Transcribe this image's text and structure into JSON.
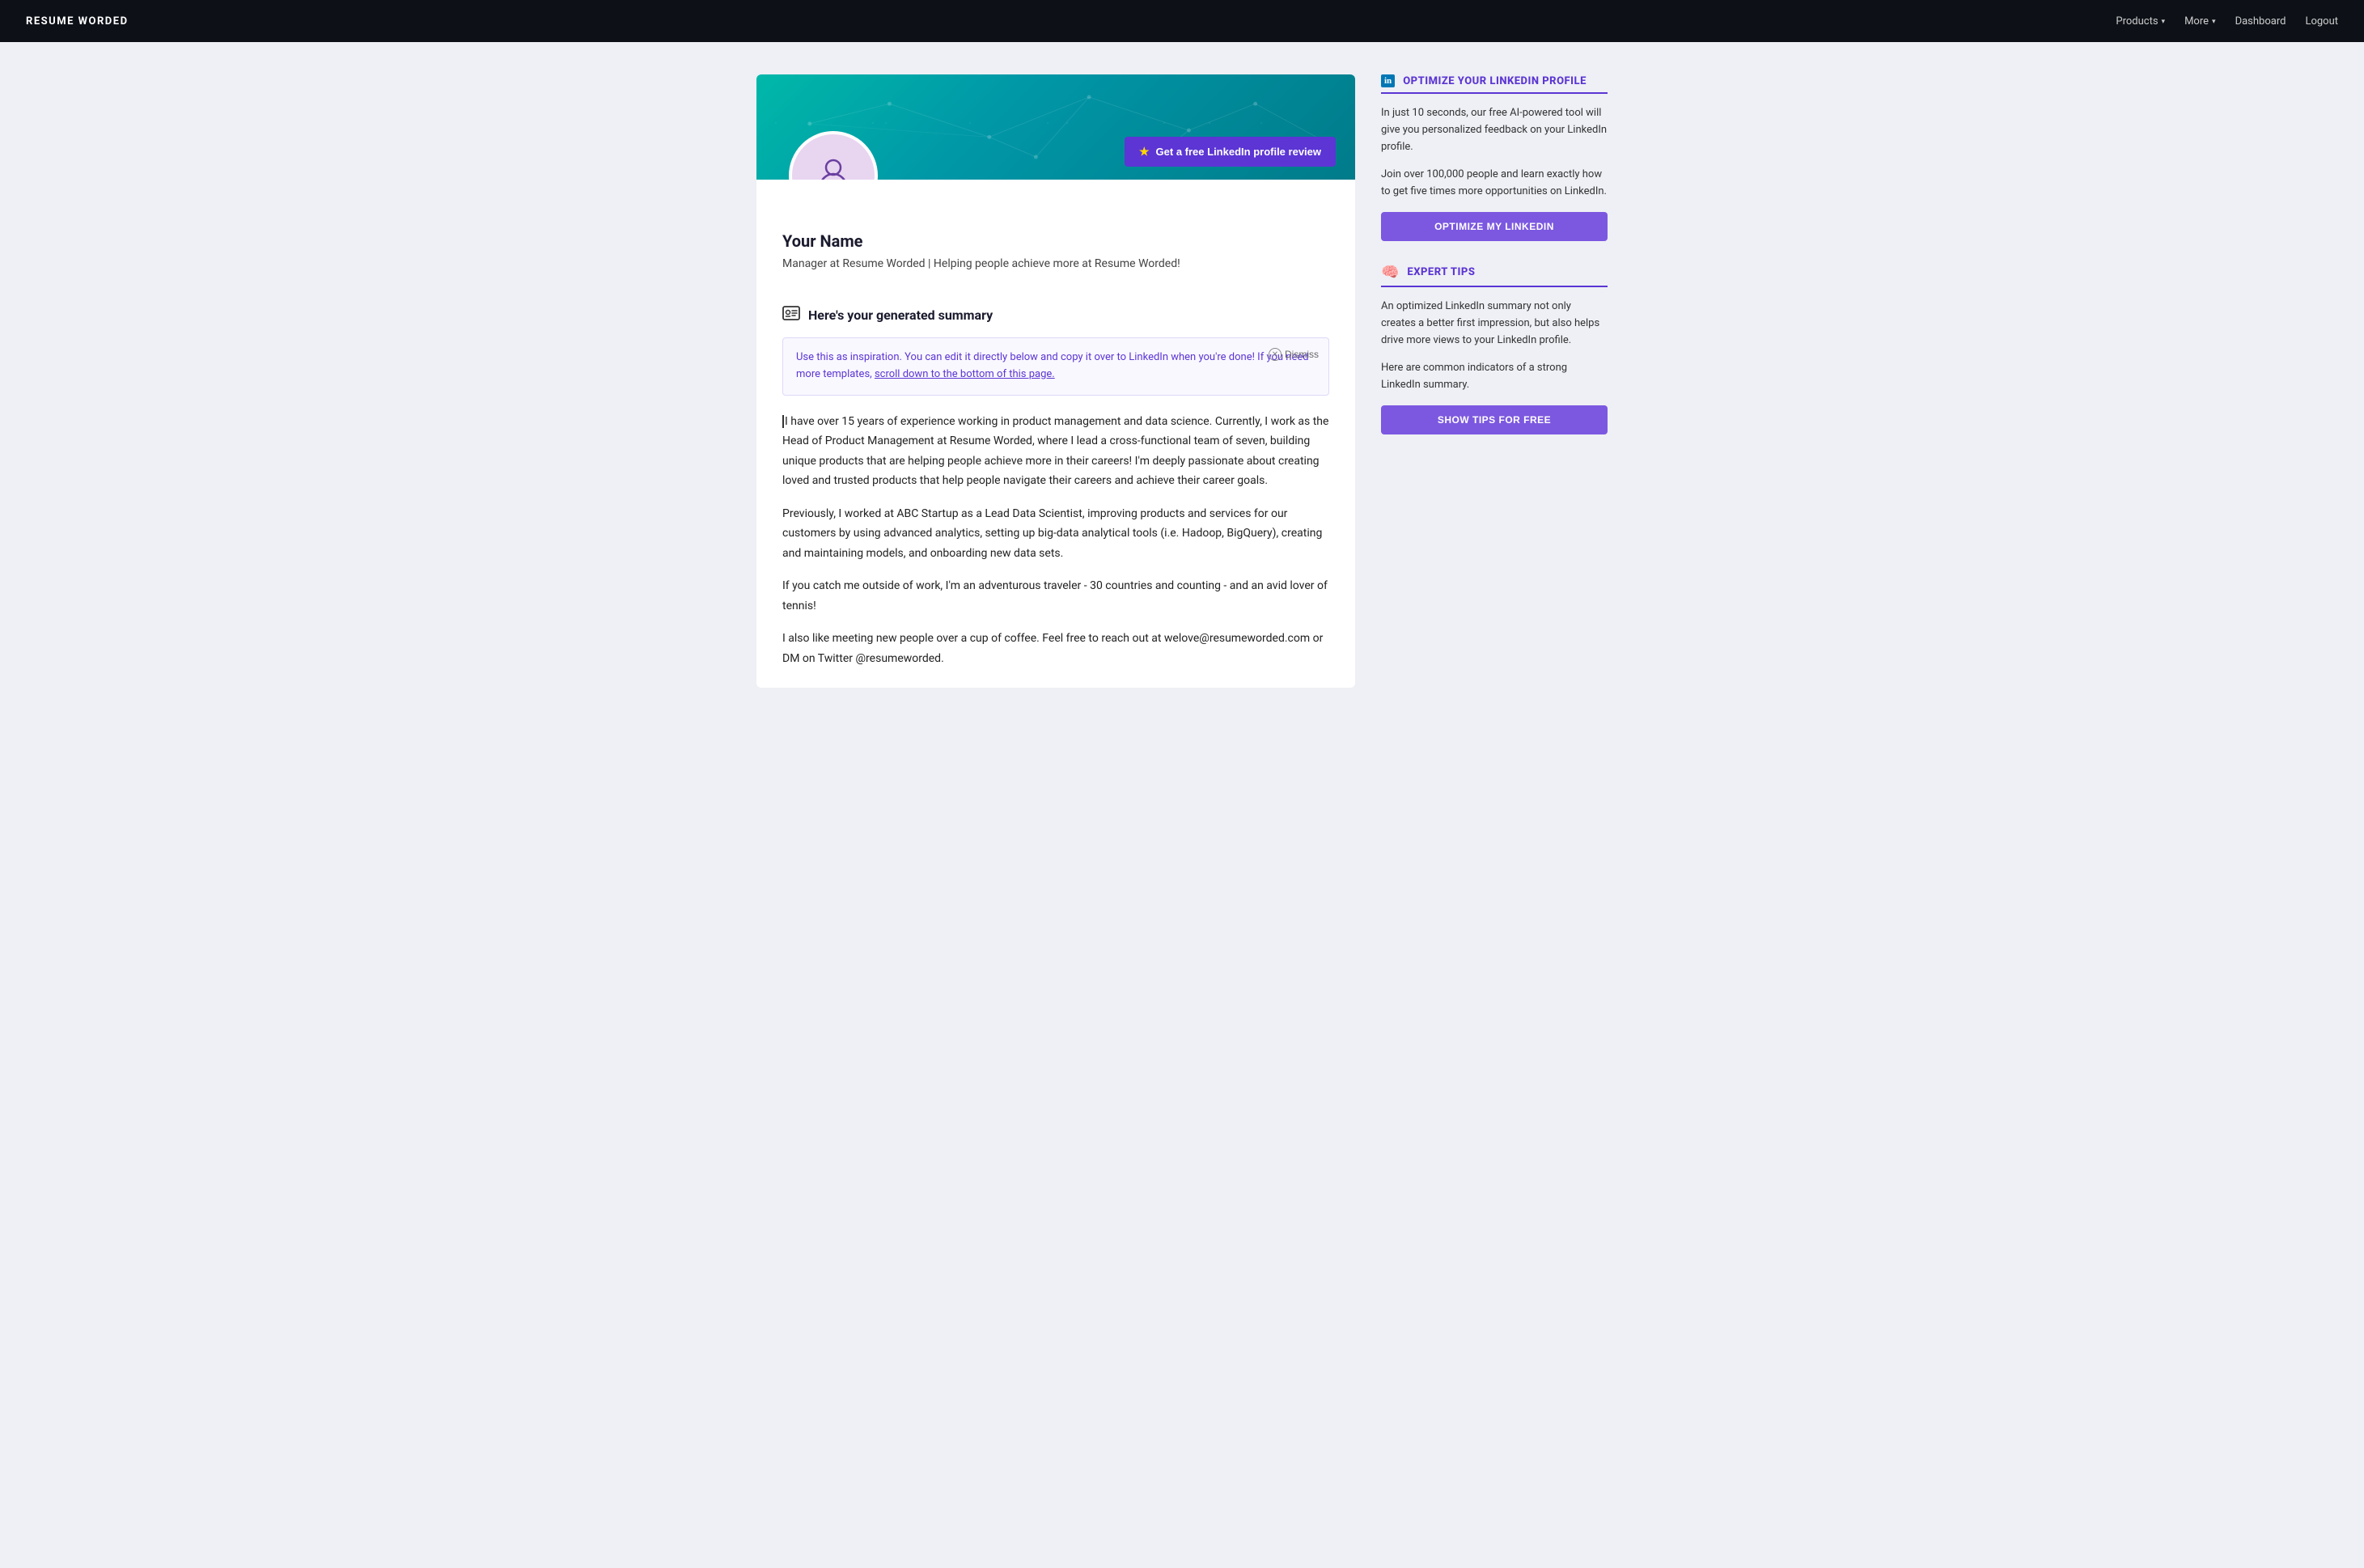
{
  "nav": {
    "logo": "RESUME WORDED",
    "products_label": "Products",
    "more_label": "More",
    "dashboard_label": "Dashboard",
    "logout_label": "Logout"
  },
  "profile": {
    "name": "Your Name",
    "title": "Manager at Resume Worded | Helping people achieve more at Resume Worded!",
    "cta_button": "Get a free LinkedIn profile review"
  },
  "summary": {
    "heading": "Here's your generated summary",
    "info_box_text": "Use this as inspiration. You can edit it directly below and copy it over to LinkedIn when you're done! If you need more templates, scroll down to the bottom of this page.",
    "dismiss_label": "Dismiss",
    "paragraph1": "I have over 15 years of experience working in product management and data science. Currently, I work as the Head of Product Management at Resume Worded, where I lead a cross-functional team of seven, building unique products that are helping people achieve more in their careers! I'm deeply passionate about creating loved and trusted products that help people navigate their careers and achieve their career goals.",
    "paragraph2": "Previously, I worked at ABC Startup as a Lead Data Scientist, improving products and services for our customers by using advanced analytics, setting up big-data analytical tools (i.e. Hadoop, BigQuery), creating and maintaining models, and onboarding new data sets.",
    "paragraph3": "If you catch me outside of work, I'm an adventurous traveler - 30 countries and counting - and an avid lover of tennis!",
    "paragraph4": "I also like meeting new people over a cup of coffee. Feel free to reach out at welove@resumeworded.com or DM on Twitter @resumeworded."
  },
  "sidebar": {
    "linkedin_card": {
      "title": "OPTIMIZE YOUR LINKEDIN PROFILE",
      "text1": "In just 10 seconds, our free AI-powered tool will give you personalized feedback on your LinkedIn profile.",
      "text2": "Join over 100,000 people and learn exactly how to get five times more opportunities on LinkedIn.",
      "button_label": "OPTIMIZE MY LINKEDIN"
    },
    "expert_card": {
      "title": "EXPERT TIPS",
      "text1": "An optimized LinkedIn summary not only creates a better first impression, but also helps drive more views to your LinkedIn profile.",
      "text2": "Here are common indicators of a strong LinkedIn summary.",
      "button_label": "SHOW TIPS FOR FREE"
    }
  }
}
